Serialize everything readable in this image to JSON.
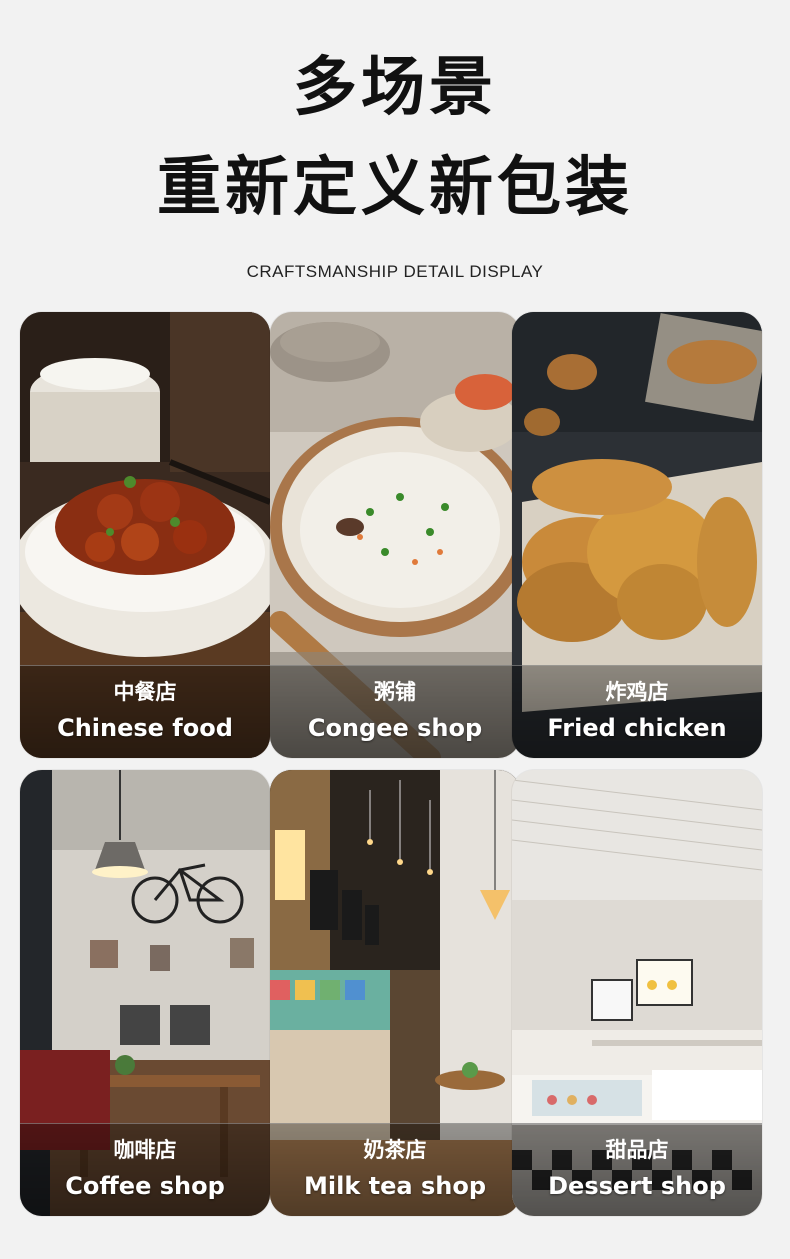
{
  "header": {
    "title_line1": "多场景",
    "title_line2": "重新定义新包装",
    "subtitle": "CRAFTSMANSHIP DETAIL DISPLAY"
  },
  "cards": [
    {
      "cn": "中餐店",
      "en": "Chinese food"
    },
    {
      "cn": "粥铺",
      "en": "Congee shop"
    },
    {
      "cn": "炸鸡店",
      "en": "Fried chicken"
    },
    {
      "cn": "咖啡店",
      "en": "Coffee shop"
    },
    {
      "cn": "奶茶店",
      "en": "Milk tea shop"
    },
    {
      "cn": "甜品店",
      "en": "Dessert shop"
    }
  ],
  "colors": {
    "background": "#f2f2f2",
    "title": "#111111",
    "label": "#ffffff"
  }
}
